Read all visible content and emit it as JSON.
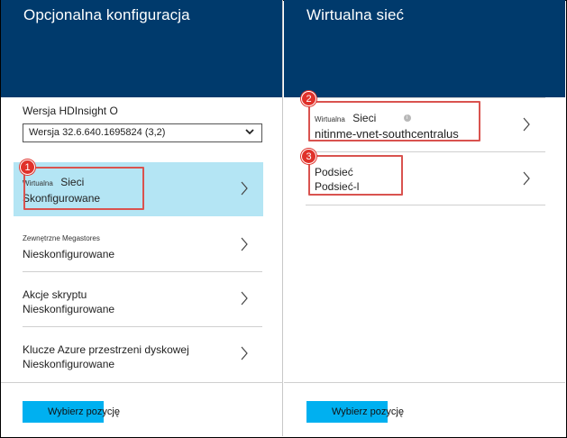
{
  "left_blade": {
    "title": "Opcjonalna konfiguracja",
    "version": {
      "label": "Wersja HDInsight O",
      "selected": "Wersja 32.6.640.1695824 (3,2)"
    },
    "items": [
      {
        "small": "Wirtualna",
        "main": "Sieci",
        "status": "Skonfigurowane",
        "badge": "1"
      },
      {
        "small": "Zewnętrzne  Megastores",
        "main": "",
        "status": "Nieskonfigurowane"
      },
      {
        "small": "",
        "main": "Akcje skryptu",
        "status": "Nieskonfigurowane"
      },
      {
        "small": "",
        "main": "Klucze Azure przestrzeni dyskowej",
        "status": "Nieskonfigurowane"
      }
    ],
    "button_label": "Wybierz pozycję"
  },
  "right_blade": {
    "title": "Wirtualna sieć",
    "items": [
      {
        "small": "Wirtualna",
        "main": "Sieci",
        "info_icon": "info-icon",
        "status": "nitinme-vnet-southcentralus",
        "badge": "2"
      },
      {
        "small": "",
        "main": "Podsieć",
        "status": "Podsieć-l",
        "badge": "3"
      }
    ],
    "button_label": "Wybierz pozycję"
  },
  "colors": {
    "header_bg": "#003a6c",
    "selected_bg": "#b4e5f4",
    "callout": "#e0312a",
    "button_fill": "#00b0f0"
  }
}
